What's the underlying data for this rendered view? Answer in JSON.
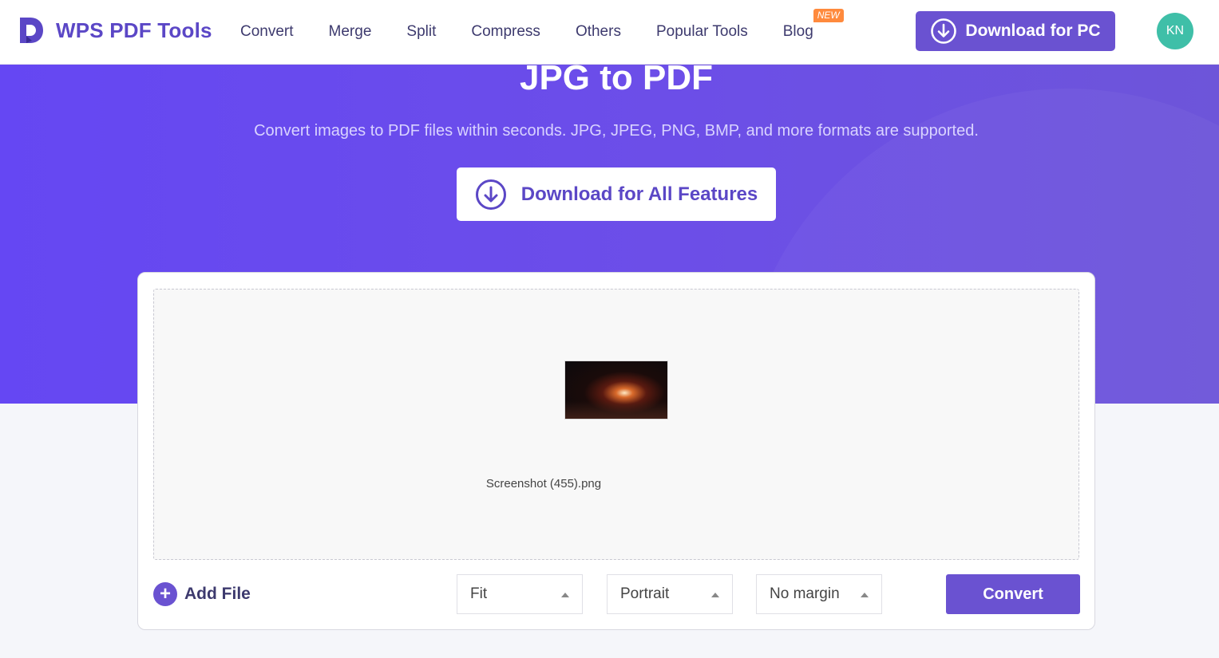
{
  "brand": {
    "name": "WPS PDF Tools",
    "color": "#5b47c6",
    "logo_icon": "wps-pdf-logo-icon"
  },
  "nav": {
    "items": [
      {
        "label": "Convert"
      },
      {
        "label": "Merge"
      },
      {
        "label": "Split"
      },
      {
        "label": "Compress"
      },
      {
        "label": "Others"
      },
      {
        "label": "Popular Tools"
      },
      {
        "label": "Blog",
        "badge": "NEW"
      }
    ]
  },
  "header": {
    "download_pc_label": "Download for PC",
    "download_icon": "download-circle-icon",
    "avatar_initials": "KN",
    "avatar_color": "#3fbfa8"
  },
  "hero": {
    "title": "JPG to PDF",
    "subtitle": "Convert images to PDF files within seconds. JPG, JPEG, PNG, BMP, and more formats are supported.",
    "download_all_label": "Download for All Features",
    "background_color": "#6547f3"
  },
  "workspace": {
    "files": [
      {
        "name": "Screenshot (455).png"
      }
    ],
    "add_file_label": "Add File",
    "page_size": {
      "selected": "Fit"
    },
    "orientation": {
      "selected": "Portrait"
    },
    "margin": {
      "selected": "No margin"
    },
    "convert_label": "Convert",
    "accent_color": "#6a52d1"
  }
}
